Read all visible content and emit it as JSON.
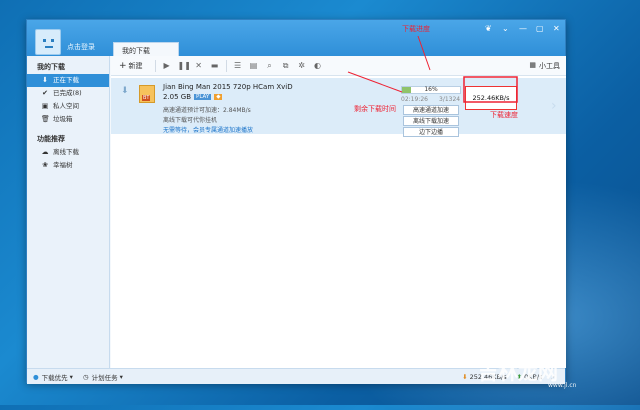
{
  "window": {
    "login_text": "点击登录",
    "tab_label": "我的下载",
    "win_controls": [
      "❦",
      "⌄",
      "—",
      "▢",
      "✕"
    ]
  },
  "sidebar": {
    "section1": "我的下载",
    "items": [
      {
        "icon": "⬇",
        "label": "正在下载"
      },
      {
        "icon": "✔",
        "label": "已完成(8)"
      },
      {
        "icon": "▣",
        "label": "私人空间"
      },
      {
        "icon": "🗑",
        "label": "垃圾箱"
      }
    ],
    "section2": "功能推荐",
    "items2": [
      {
        "icon": "☁",
        "label": "离线下载"
      },
      {
        "icon": "❀",
        "label": "幸福树"
      }
    ]
  },
  "toolbar": {
    "new_label": "新建",
    "tools_label": "小工具"
  },
  "task": {
    "name": "Jian Bing Man 2015 720p HCam XviD",
    "size": "2.05 GB",
    "play": "PLAY",
    "info1": "高速通道预计可加速：2.84MB/s",
    "info2": "离线下载可代你挂机",
    "info3": "无需等待，会员专属通道加速播放",
    "progress_pct": "16%",
    "progress_value": 0.16,
    "eta": "02:19:26",
    "chunks": "3/1324",
    "btn_highspeed": "高速通道加速",
    "btn_offline": "离线下载加速",
    "btn_play": "边下边播",
    "speed": "252.46KB/s"
  },
  "status": {
    "priority": "下载优先",
    "plan": "计划任务",
    "down_speed": "252.46KB/s",
    "up_speed": "0KB/s"
  },
  "annotations": {
    "progress": "下载进度",
    "remaining": "剩余下载时间",
    "speed": "下载速度"
  },
  "watermark": {
    "text": "吉林龙网",
    "sub": "www.jl.cn"
  },
  "colors": {
    "accent": "#2f8fd8",
    "annotation": "#e22233",
    "progress": "#8fc36a"
  }
}
